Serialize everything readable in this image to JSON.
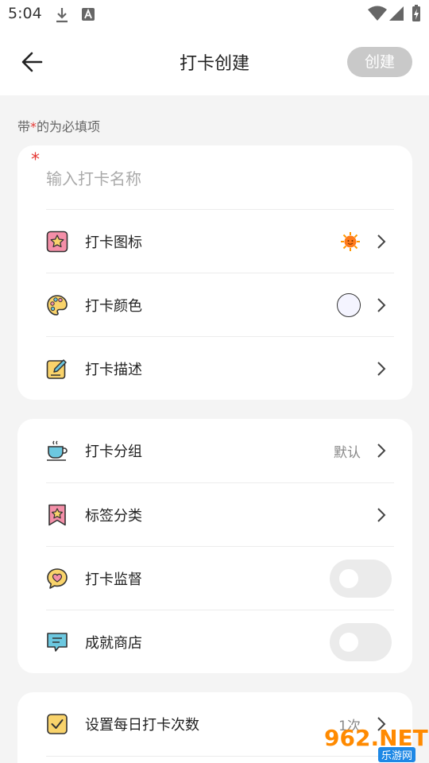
{
  "status_bar": {
    "time": "5:04",
    "icons": [
      "download-icon",
      "text-a-icon",
      "wifi-icon",
      "signal-icon",
      "battery-charging-icon"
    ]
  },
  "header": {
    "back_icon": "arrow-left-icon",
    "title": "打卡创建",
    "create_label": "创建"
  },
  "hint": {
    "prefix": "带",
    "star": "*",
    "suffix": "的为必填项"
  },
  "card1": {
    "required_star": "*",
    "name_placeholder": "输入打卡名称",
    "rows": [
      {
        "icon": "star-frame-icon",
        "label": "打卡图标",
        "value_icon": "sun-face-icon"
      },
      {
        "icon": "palette-icon",
        "label": "打卡颜色",
        "value_color": "#f4f4ff"
      },
      {
        "icon": "edit-note-icon",
        "label": "打卡描述"
      }
    ]
  },
  "card2": {
    "rows": [
      {
        "icon": "cup-icon",
        "label": "打卡分组",
        "value": "默认"
      },
      {
        "icon": "bookmark-star-icon",
        "label": "标签分类"
      },
      {
        "icon": "heart-bubble-icon",
        "label": "打卡监督",
        "toggle": false
      },
      {
        "icon": "message-bubble-icon",
        "label": "成就商店",
        "toggle": false
      }
    ]
  },
  "card3": {
    "rows": [
      {
        "icon": "checkbox-icon",
        "label": "设置每日打卡次数",
        "value": "1次"
      }
    ]
  },
  "watermark": {
    "top": "962.NET",
    "bottom": "乐游网"
  },
  "colors": {
    "accent_star": "#e53935",
    "create_button_disabled": "#c9c9c9",
    "icon_yellow": "#f9d36b",
    "icon_pink": "#f48fa8",
    "icon_teal": "#6cc8e0"
  }
}
